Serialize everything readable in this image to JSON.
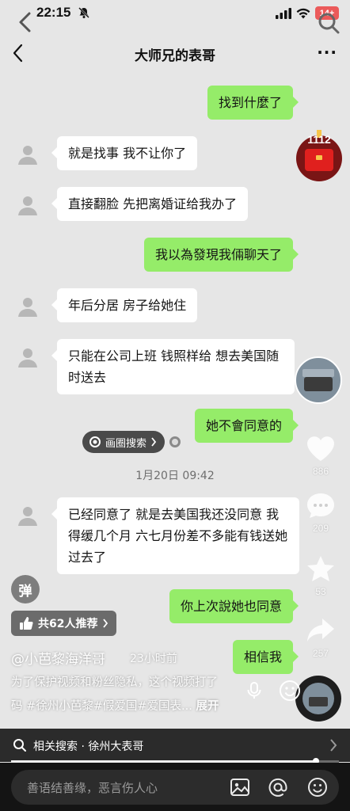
{
  "status_bar": {
    "time": "22:15",
    "battery": "14+"
  },
  "chat": {
    "title": "大师兄的表哥",
    "more": "···",
    "messages": [
      {
        "side": "out",
        "text": "找到什麼了"
      },
      {
        "side": "in",
        "text": "就是找事 我不让你了"
      },
      {
        "side": "in",
        "text": "直接翻脸 先把离婚证给我办了"
      },
      {
        "side": "out",
        "text": "我以為發現我倆聊天了"
      },
      {
        "side": "in",
        "text": "年后分居 房子给她住"
      },
      {
        "side": "in",
        "text": "只能在公司上班 钱照样给 想去美国随时送去"
      },
      {
        "side": "out",
        "text": "她不會同意的"
      },
      {
        "side": "in",
        "text": "已经同意了 就是去美国我还没同意 我得缓几个月 六七月份差不多能有钱送她过去了"
      },
      {
        "side": "out",
        "text": "你上次說她也同意"
      },
      {
        "side": "out",
        "text": "相信我"
      }
    ],
    "timestamp": "1月20日 09:42",
    "circle_search_label": "画圈搜索"
  },
  "rail": {
    "red_packet_count": "1112",
    "likes": "886",
    "comments": "209",
    "favorites": "53",
    "shares": "257"
  },
  "overlay": {
    "danmu_label": "弹",
    "recommend_label": "共62人推荐",
    "author": "@小芭黎海洋哥",
    "time_ago": "23小时前",
    "desc_line1": "为了保护视频和粉丝隐私，这个视频打了",
    "desc_line2": "码 #徐州小芭黎#假爱国#爱国表...",
    "expand": "展开",
    "related_search": "相关搜索 · 徐州大表哥",
    "progress": 0.93,
    "comment_placeholder": "善语结善缘，恶言伤人心"
  }
}
